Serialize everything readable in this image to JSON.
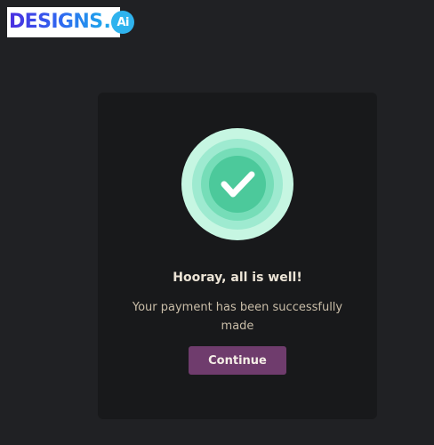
{
  "logo": {
    "text": "DESIGNS",
    "dot": ".",
    "ai_mark": "Ai"
  },
  "card": {
    "badge_icon": "checkmark-icon",
    "title": "Hooray, all is well!",
    "message": "Your payment has been successfully made",
    "continue_label": "Continue"
  },
  "colors": {
    "page_background": "#202124",
    "card_background": "#18191b",
    "button": "#6f3c6d",
    "badge_outer": "#b4f0d8",
    "badge_inner": "#4cc99b",
    "check": "#ffffff"
  }
}
